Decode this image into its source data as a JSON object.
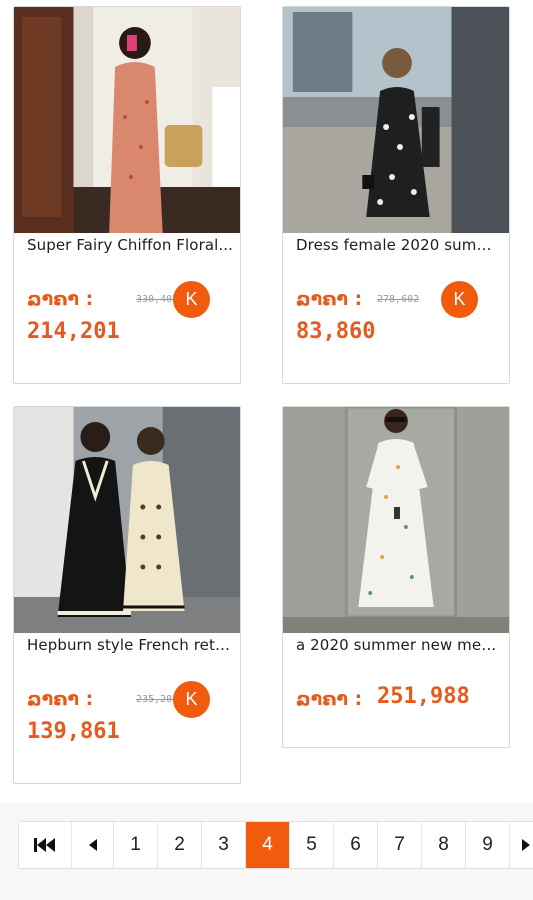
{
  "products": [
    {
      "title": "Super Fairy Chiffon Floral...",
      "price_label": "ລາຄາ :",
      "old_price": "330,402",
      "badge": "K",
      "price": "214,201",
      "photo": "woman in pink floral dress taking mirror selfie"
    },
    {
      "title": "Dress female 2020 summ...",
      "price_label": "ລາຄາ :",
      "old_price": "278,602",
      "badge": "K",
      "price": "83,860",
      "photo": "woman in black floral slip dress"
    },
    {
      "title": "Hepburn style French retr...",
      "price_label": "ລາຄາ :",
      "old_price": "235,201",
      "badge": "K",
      "price": "139,861",
      "photo": "two women in black and cream dresses"
    },
    {
      "title": "a 2020 summer new mes...",
      "price_label": "ລາຄາ :",
      "price": "251,988",
      "photo": "woman in white floral mesh dress"
    }
  ],
  "pagination": {
    "first_icon": "skip-to-first-icon",
    "prev_icon": "caret-left-icon",
    "next_icon": "caret-right-icon",
    "pages": [
      "1",
      "2",
      "3",
      "4",
      "5",
      "6",
      "7",
      "8",
      "9"
    ],
    "current": "4"
  },
  "colors": {
    "accent": "#f25a0e",
    "price": "#e8591d"
  }
}
